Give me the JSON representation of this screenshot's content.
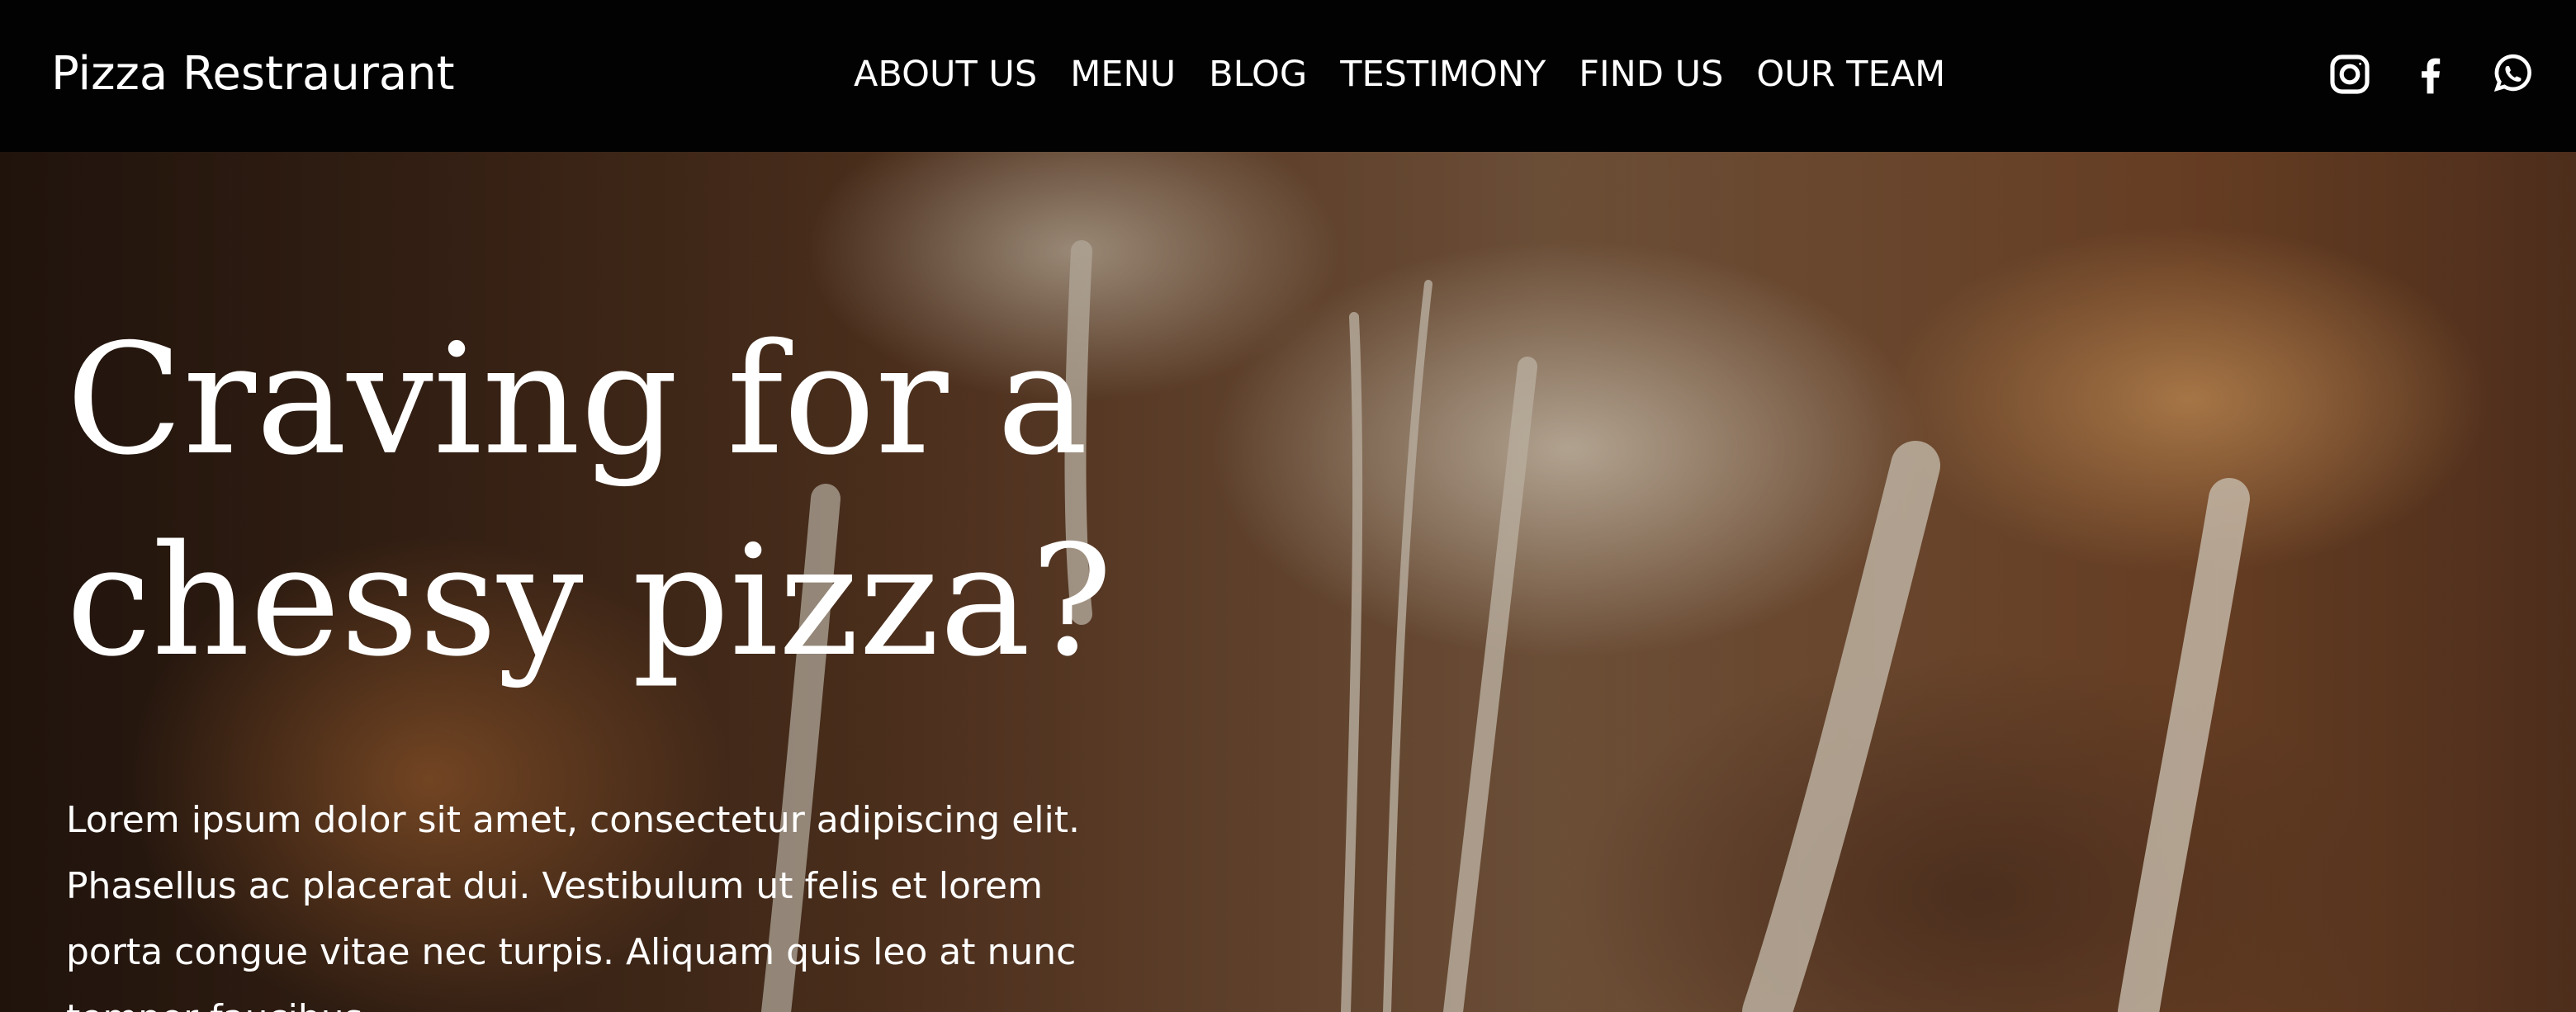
{
  "header": {
    "brand": "Pizza Restraurant",
    "nav": [
      "ABOUT US",
      "MENU",
      "BLOG",
      "TESTIMONY",
      "FIND US",
      "OUR TEAM"
    ],
    "socials": [
      "instagram-icon",
      "facebook-icon",
      "whatsapp-icon"
    ]
  },
  "hero": {
    "title_line1": "Craving for a",
    "title_line2": "chessy pizza?",
    "text": "Lorem ipsum dolor sit amet, consectetur adipiscing elit. Phasellus ac placerat dui. Vestibulum ut felis et lorem porta congue vitae nec turpis. Aliquam quis leo at nunc tempor faucibus"
  },
  "colors": {
    "header_bg": "#020202",
    "text": "#ffffff"
  }
}
